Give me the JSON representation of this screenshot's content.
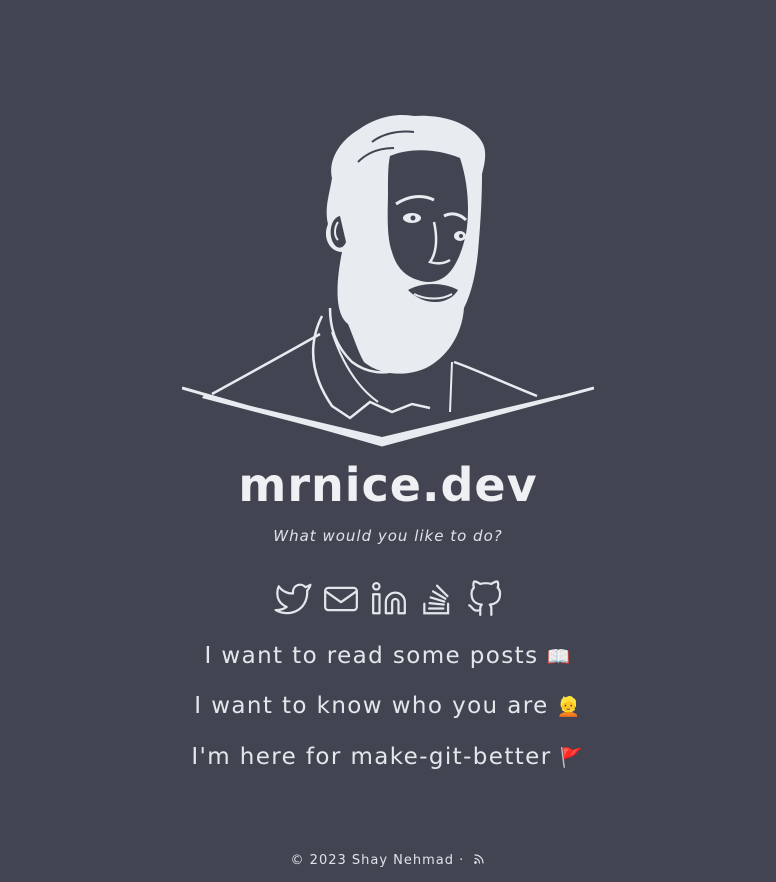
{
  "site": {
    "title": "mrnice.dev",
    "tagline": "What would you like to do?"
  },
  "social": [
    {
      "name": "twitter-icon"
    },
    {
      "name": "email-icon"
    },
    {
      "name": "linkedin-icon"
    },
    {
      "name": "stackoverflow-icon"
    },
    {
      "name": "github-icon"
    }
  ],
  "links": [
    {
      "text": "I want to read some posts",
      "emoji": "📖"
    },
    {
      "text": "I want to know who you are",
      "emoji": "👱"
    },
    {
      "text": "I'm here for make-git-better",
      "emoji": "🚩"
    }
  ],
  "footer": {
    "copyright": "© 2023 Shay Nehmad",
    "separator": "·"
  },
  "colors": {
    "background": "#424551",
    "foreground": "#e6e9ee"
  }
}
